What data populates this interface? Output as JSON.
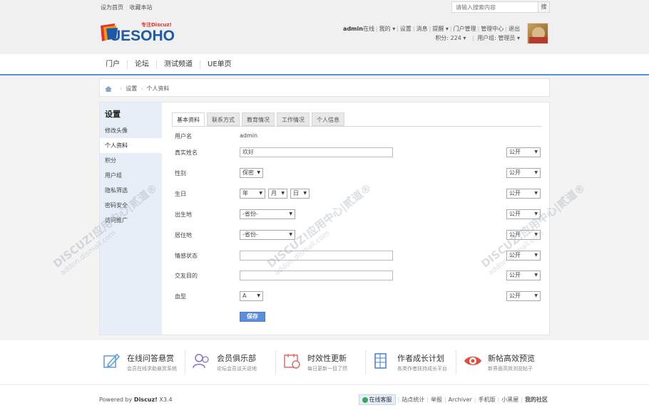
{
  "topbar": {
    "set_home": "设为首页",
    "bookmark": "收藏本站",
    "search_placeholder": "请输入搜索内容",
    "search_btn": "搜"
  },
  "logo": {
    "text": "UESOHO",
    "tag": "专注Discuz!"
  },
  "user": {
    "name": "admin",
    "status": "在线",
    "links": [
      "我的",
      "设置",
      "消息",
      "提醒",
      "门户管理",
      "管理中心",
      "退出"
    ],
    "points": "积分: 224",
    "group": "用户组: 管理员"
  },
  "nav": [
    "门户",
    "论坛",
    "测试频道",
    "UE单页"
  ],
  "breadcrumb": {
    "items": [
      "设置",
      "个人资料"
    ]
  },
  "sidebar": {
    "title": "设置",
    "items": [
      "修改头像",
      "个人资料",
      "积分",
      "用户组",
      "隐私筛选",
      "密码安全",
      "访问推广"
    ],
    "active": "个人资料"
  },
  "tabs": [
    "基本资料",
    "联系方式",
    "教育情况",
    "工作情况",
    "个人信息"
  ],
  "form": {
    "username_label": "用户名",
    "username_value": "admin",
    "realname_label": "真实姓名",
    "realname_value": "欢好",
    "gender_label": "性别",
    "gender_value": "保密",
    "birthday_label": "生日",
    "birth_year": "年",
    "birth_month": "月",
    "birth_day": "日",
    "birthplace_label": "出生地",
    "birthplace_value": "-省份-",
    "residence_label": "居住地",
    "residence_value": "-省份-",
    "affective_label": "情感状态",
    "affective_value": "",
    "lookingfor_label": "交友目的",
    "lookingfor_value": "",
    "bloodtype_label": "血型",
    "bloodtype_value": "A",
    "privacy_value": "公开",
    "save_label": "保存"
  },
  "watermark": {
    "line1": "DISCUZ!应用中心|贰道®",
    "line2": "addon.dismall.com"
  },
  "features": [
    {
      "title": "在线问答悬赏",
      "sub": "会员在线求助悬赏系统"
    },
    {
      "title": "会员俱乐部",
      "sub": "论坛会员谈天说地"
    },
    {
      "title": "时效性更新",
      "sub": "每日更新一目了然"
    },
    {
      "title": "作者成长计划",
      "sub": "各类作者扶持成长平台"
    },
    {
      "title": "新帖高效预览",
      "sub": "新界面高效浏览帖子"
    }
  ],
  "footer": {
    "powered": "Powered by",
    "brand": "Discuz!",
    "version": "X3.4",
    "consult": "在线客服",
    "links": [
      "站点统计",
      "举报",
      "Archiver",
      "手机版",
      "小黑屋"
    ],
    "community": "我的社区"
  },
  "colors": {
    "accent": "#5a8fdb",
    "sidebar_bg": "#e8eef7"
  }
}
